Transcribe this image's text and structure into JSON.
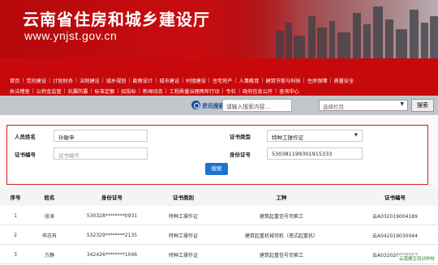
{
  "header": {
    "title": "云南省住房和城乡建设厅",
    "url": "www.ynjst.gov.cn"
  },
  "nav": {
    "row1": [
      "首页",
      "党的建设",
      "计划财务",
      "法制建设",
      "城乡规划",
      "勘察设计",
      "城市建设",
      "村镇建设",
      "住宅房产",
      "人事教育",
      "建筑节能与科技",
      "住房保障",
      "质量安全"
    ],
    "row2": [
      "执法稽查",
      "公积金监管",
      "抗震防震",
      "标准定额",
      "招投标",
      "新闻动态",
      "工程质量治理两年行动",
      "专栏",
      "政府信息公开",
      "查询中心"
    ]
  },
  "search_bar": {
    "label": "资讯搜索",
    "placeholder": "请输入搜索内容...",
    "select_value": "选择栏目",
    "button": "搜索"
  },
  "form": {
    "name_label": "人员姓名",
    "name_value": "孙敏申",
    "cert_type_label": "证书类型",
    "cert_type_value": "特种工操作证",
    "cert_no_label": "证书编号",
    "cert_no_placeholder": "证书编号",
    "id_label": "身份证号",
    "id_value": "530381199301915333",
    "search_button": "搜索"
  },
  "table": {
    "headers": [
      "序号",
      "姓名",
      "身份证号",
      "证书类别",
      "工种",
      "证书编号"
    ],
    "rows": [
      [
        "1",
        "张涛",
        "530328********0931",
        "特种工操作证",
        "建筑起重信号司索工",
        "云A032019004189"
      ],
      [
        "2",
        "申志有",
        "532329********2135",
        "特种工操作证",
        "建筑起重机械司机（塔式起重机）",
        "云A042019030044"
      ],
      [
        "3",
        "方静",
        "342426********1046",
        "特种工操作证",
        "建筑起重信号司索工",
        "云A032020009063"
      ]
    ]
  },
  "watermark": "云南建企培训学校",
  "colors": {
    "banner_red": "#c80d10",
    "nav_red": "#c8090c",
    "form_border": "#d9191e",
    "search_button": "#1b74d0"
  }
}
